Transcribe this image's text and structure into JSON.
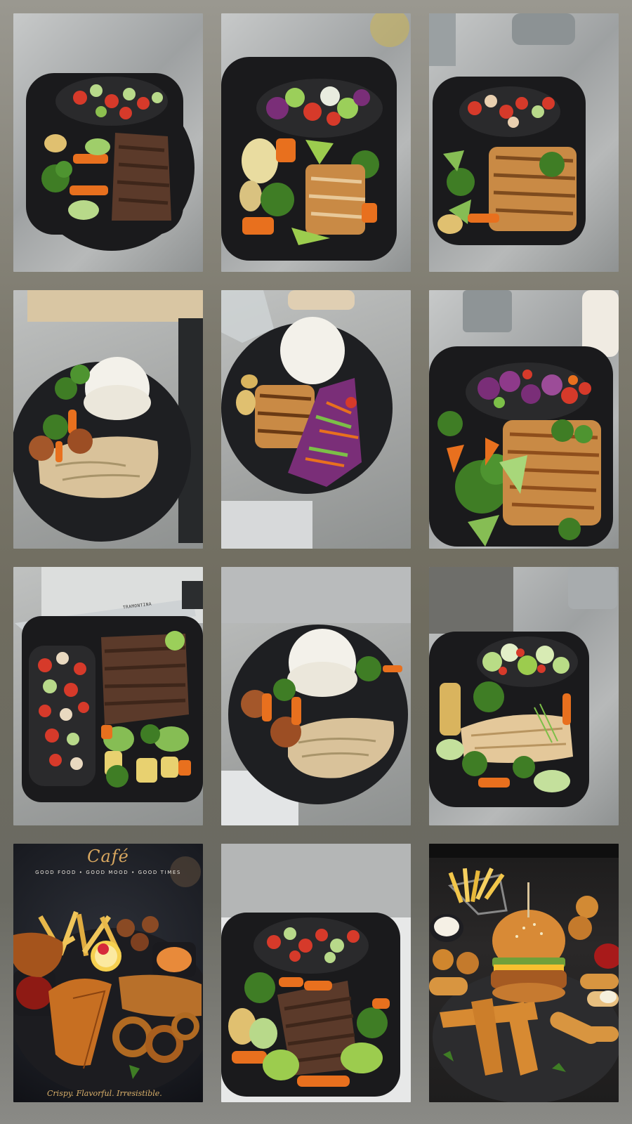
{
  "gallery": {
    "tiles": [
      {
        "id": 1,
        "label": "Takeaway box: tomato-cucumber salad, grilled vegetables, sliced steak"
      },
      {
        "id": 2,
        "label": "Takeaway box: red cabbage salad, potatoes, avocado, grilled chicken"
      },
      {
        "id": 3,
        "label": "Takeaway box: tomato salsa, broccoli, grilled chicken strips"
      },
      {
        "id": 4,
        "label": "Plate: rice dome, creamy stroganoff, falafel, broccoli"
      },
      {
        "id": 5,
        "label": "Plate: rice dome, grilled chicken, cabbage slaw, potatoes"
      },
      {
        "id": 6,
        "label": "Takeaway box: cabbage salad, broccoli, grilled chicken"
      },
      {
        "id": 7,
        "label": "Takeaway box: salsa, steak strips, grilled pineapple, vegetables"
      },
      {
        "id": 8,
        "label": "Plate: rice dome, creamy sauce, falafel, carrots, broccoli"
      },
      {
        "id": 9,
        "label": "Takeaway box: green salad, chicken, broccoli, cucumber"
      },
      {
        "id": 10,
        "label": "Café platter: fries, fried chicken, onion rings, dips"
      },
      {
        "id": 11,
        "label": "Takeaway box: salsa, steak, carrots, broccoli"
      },
      {
        "id": 12,
        "label": "Slate board: crispy chicken burger, fries basket, tenders, croquettes"
      }
    ]
  },
  "cafe_poster": {
    "title": "Café",
    "subtitle": "GOOD FOOD • GOOD MOOD • GOOD TIMES",
    "tagline": "Crispy. Flavorful. Irresistible."
  },
  "knife": {
    "brand": "TRAMONTINA"
  },
  "colors": {
    "tray": "#1a1a1c",
    "plate": "#1e1f22",
    "rice": "#f3f1ea",
    "broccoli": "#3f7d25",
    "carrot": "#e8701e",
    "tomato": "#d63a2a",
    "cucumber": "#b8d98a",
    "chicken": "#c98a45",
    "steak": "#5b3a2a",
    "sauce": "#d9c29a",
    "cabbage": "#7a2e78",
    "accent_gold": "#d9a860"
  }
}
